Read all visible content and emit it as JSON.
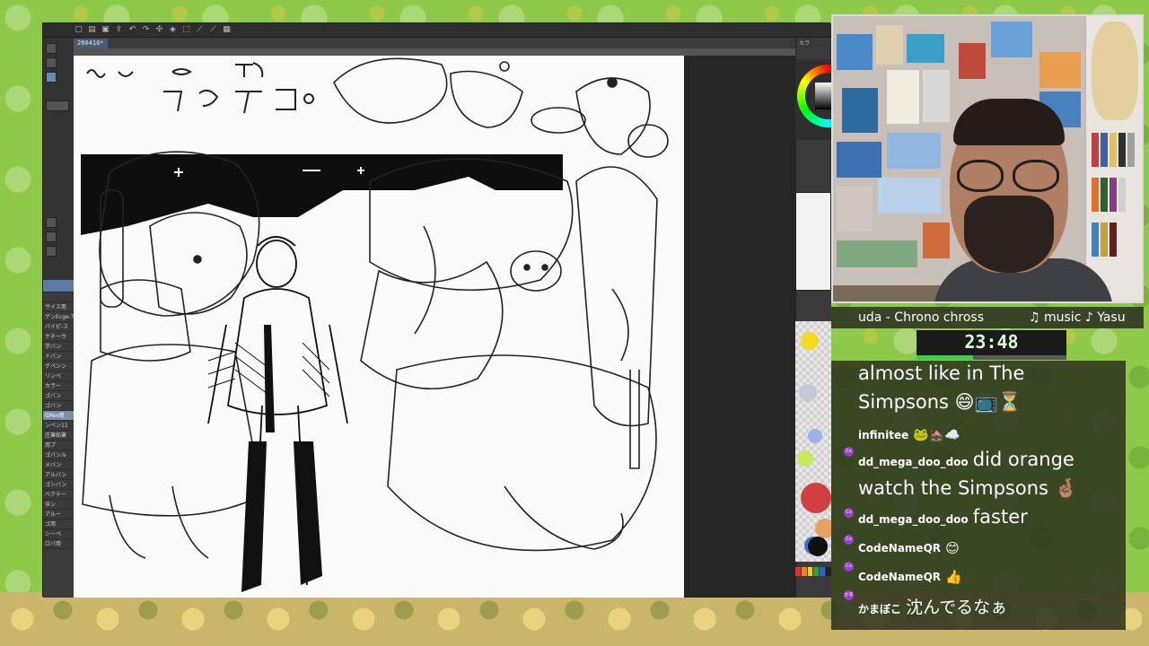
{
  "canvas": {
    "document_tab": "260410*",
    "brush_panel_items": [
      "",
      "サイス用",
      "ゲンEcge-7",
      "バイビ-ス",
      "ケチーウ",
      "学バン",
      "ドバン",
      "ゲペンン",
      "リンベ",
      "カラー",
      "ゴバン",
      "ゴバン",
      "GPen用",
      "ンペン11",
      "圧筆鉛筆",
      "用プ",
      "ゴバンル",
      "メバン",
      "アルバン",
      "ゴシバン",
      "ベクテー",
      "ゆン",
      "アルー",
      "ゴ用",
      "シーペ",
      "ロバ用"
    ]
  },
  "right_panel": {
    "label": "カラ",
    "palette_colors": [
      "#e03030",
      "#f08020",
      "#f0d020",
      "#30a040",
      "#3060d0",
      "#202020"
    ],
    "swatches": [
      "#f5d820",
      "#c8c8d8",
      "#a0b0e8",
      "#d04040",
      "#e8a060",
      "#4070d0",
      "#101010",
      "#c8e860"
    ]
  },
  "stream": {
    "ticker_left": "uda - Chrono chross",
    "ticker_right": "♫ music ♪ Yasu",
    "timer": "23:48",
    "timer_progress": 0.38
  },
  "chat": {
    "messages": [
      {
        "type": "continuation",
        "text_1": "almost like in The",
        "text_2": "Simpsons 😄📺⏳"
      },
      {
        "type": "emote",
        "user": "infinitee",
        "text": "🐸🏚️☁️"
      },
      {
        "type": "msg",
        "badge": "Co",
        "user": "dd_mega_doo_doo",
        "text_1": "did orange",
        "text_2": "watch the Simpsons 🤞🏽"
      },
      {
        "type": "msg",
        "badge": "Co",
        "user": "dd_mega_doo_doo",
        "text": "faster"
      },
      {
        "type": "emote",
        "badge": "Co",
        "user": "CodeNameQR",
        "text": "😊"
      },
      {
        "type": "emote",
        "badge": "Co",
        "user": "CodeNameQR",
        "text": "👍"
      },
      {
        "type": "msg",
        "badge": "かま",
        "user": "かまぼこ",
        "text": "沈んでるなぁ"
      }
    ]
  },
  "colors": {
    "chat_bg": "#2d341e",
    "timer_green": "#3ad04a",
    "background_green": "#8fc94a"
  }
}
